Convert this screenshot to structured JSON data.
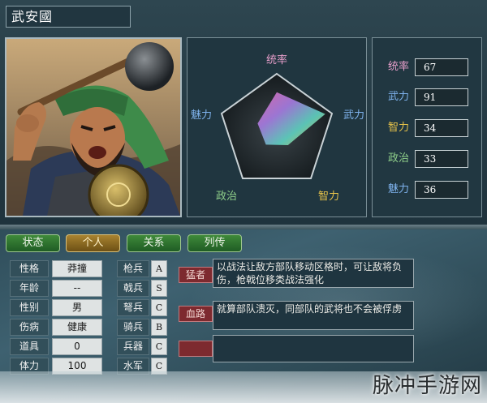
{
  "general": {
    "name": "武安國"
  },
  "radar": {
    "labels": {
      "lead": "统率",
      "war": "武力",
      "int": "智力",
      "pol": "政治",
      "chr": "魅力"
    },
    "label_colors": {
      "lead": "#e79fcb",
      "war": "#7fb3ee",
      "int": "#e6c24a",
      "pol": "#8fcf8a",
      "chr": "#7fb3ee"
    },
    "max_value": 100
  },
  "stats": [
    {
      "label": "统率",
      "value": "67",
      "color": "#e79fcb"
    },
    {
      "label": "武力",
      "value": "91",
      "color": "#7fb3ee"
    },
    {
      "label": "智力",
      "value": "34",
      "color": "#e6c24a"
    },
    {
      "label": "政治",
      "value": "33",
      "color": "#8fcf8a"
    },
    {
      "label": "魅力",
      "value": "36",
      "color": "#7fb3ee"
    }
  ],
  "tabs": [
    {
      "label": "状态",
      "active": false
    },
    {
      "label": "个人",
      "active": true
    },
    {
      "label": "关系",
      "active": false
    },
    {
      "label": "列传",
      "active": false
    }
  ],
  "info": [
    {
      "label": "性格",
      "value": "莽撞"
    },
    {
      "label": "年龄",
      "value": "--"
    },
    {
      "label": "性别",
      "value": "男"
    },
    {
      "label": "伤病",
      "value": "健康"
    },
    {
      "label": "道具",
      "value": "0"
    },
    {
      "label": "体力",
      "value": "100"
    }
  ],
  "arms": [
    {
      "label": "枪兵",
      "grade": "A"
    },
    {
      "label": "戟兵",
      "grade": "S"
    },
    {
      "label": "弩兵",
      "grade": "C"
    },
    {
      "label": "骑兵",
      "grade": "B"
    },
    {
      "label": "兵器",
      "grade": "C"
    },
    {
      "label": "水军",
      "grade": "C"
    }
  ],
  "skills": [
    {
      "tag": "猛者",
      "desc": "以战法让敌方部队移动区格时，可让敌将负伤，枪戟位移类战法强化"
    },
    {
      "tag": "血路",
      "desc": "就算部队溃灭，同部队的武将也不会被俘虏"
    },
    {
      "tag": "",
      "desc": ""
    }
  ],
  "watermark": "脉冲手游网"
}
